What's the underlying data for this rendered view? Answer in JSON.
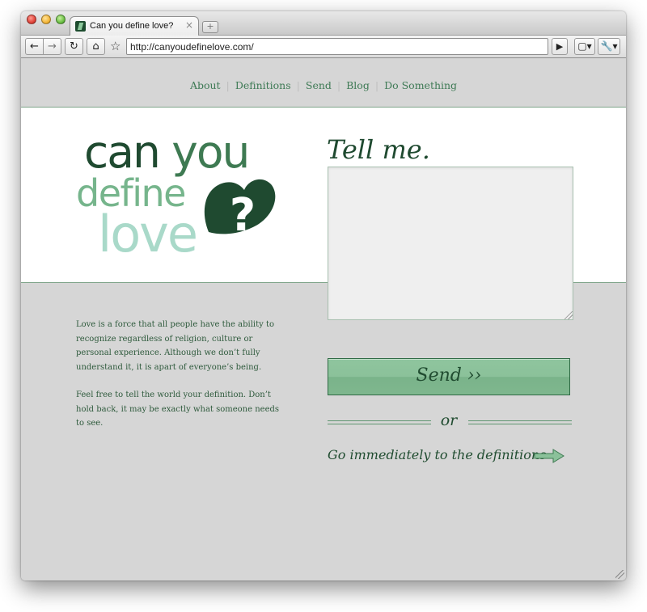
{
  "window": {
    "tab_title": "Can you define love?",
    "tab_close": "×",
    "new_tab": "+",
    "url": "http://canyoudefinelove.com/"
  },
  "toolbar": {
    "back": "←",
    "forward": "→",
    "reload": "↻",
    "home": "⌂",
    "bookmark": "☆",
    "go": "▶",
    "page_menu": "▢▾",
    "wrench_menu": "🔧▾"
  },
  "nav": {
    "items": [
      {
        "label": "About"
      },
      {
        "label": "Definitions"
      },
      {
        "label": "Send"
      },
      {
        "label": "Blog"
      },
      {
        "label": "Do Something"
      }
    ]
  },
  "logo": {
    "can": "can",
    "you": "you",
    "define": "define",
    "love": "love",
    "heart_mark": "?"
  },
  "form": {
    "heading": "Tell me.",
    "textarea_value": "",
    "send_label": "Send ››",
    "or_label": "or",
    "definitions_link": "Go immediately to the definitions"
  },
  "intro": {
    "paragraph1": "Love is a force that all people have the ability to recognize regardless of religion, culture or personal experience. Although we don’t fully understand it, it is apart of everyone’s being.",
    "paragraph2": "Feel free to tell the world your definition. Don’t hold back, it may be exactly what someone needs to see."
  },
  "colors": {
    "dark_green": "#1f4a30",
    "mid_green": "#3e7a52",
    "light_green": "#76b58c",
    "mint": "#a9d9c9",
    "button_green": "#8bc19a",
    "page_gray": "#d6d6d6"
  }
}
